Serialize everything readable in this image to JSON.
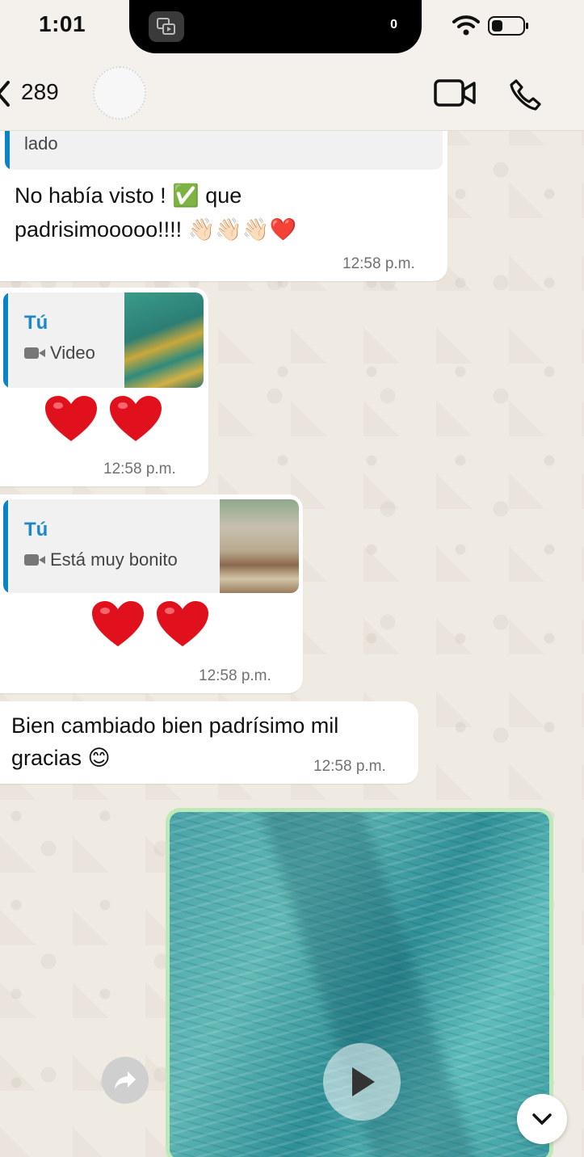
{
  "status": {
    "time": "1:01",
    "island_count": "0",
    "battery_level": 0.35
  },
  "header": {
    "back_count": "289",
    "back_icon": "chevron-left-icon",
    "video_icon": "video-camera-icon",
    "call_icon": "phone-icon"
  },
  "messages": [
    {
      "quoted_text": "lado",
      "text_line1": "No había visto ! ✅ que",
      "text_line2": "padrisimooooo!!!! 👋🏻👋🏻👋🏻❤️",
      "time": "12:58 p.m."
    },
    {
      "quote_name": "Tú",
      "quote_sub": "Video",
      "time": "12:58 p.m."
    },
    {
      "quote_name": "Tú",
      "quote_sub": "Está muy bonito",
      "time": "12:58 p.m."
    },
    {
      "text_line1": "Bien cambiado bien padrísimo mil",
      "text_line2": "gracias 😊",
      "time": "12:58 p.m."
    }
  ],
  "colors": {
    "quote_accent": "#0b84c6",
    "quote_name": "#1e88c7",
    "video_border": "#bde8b7",
    "heart": "#e0111d"
  }
}
